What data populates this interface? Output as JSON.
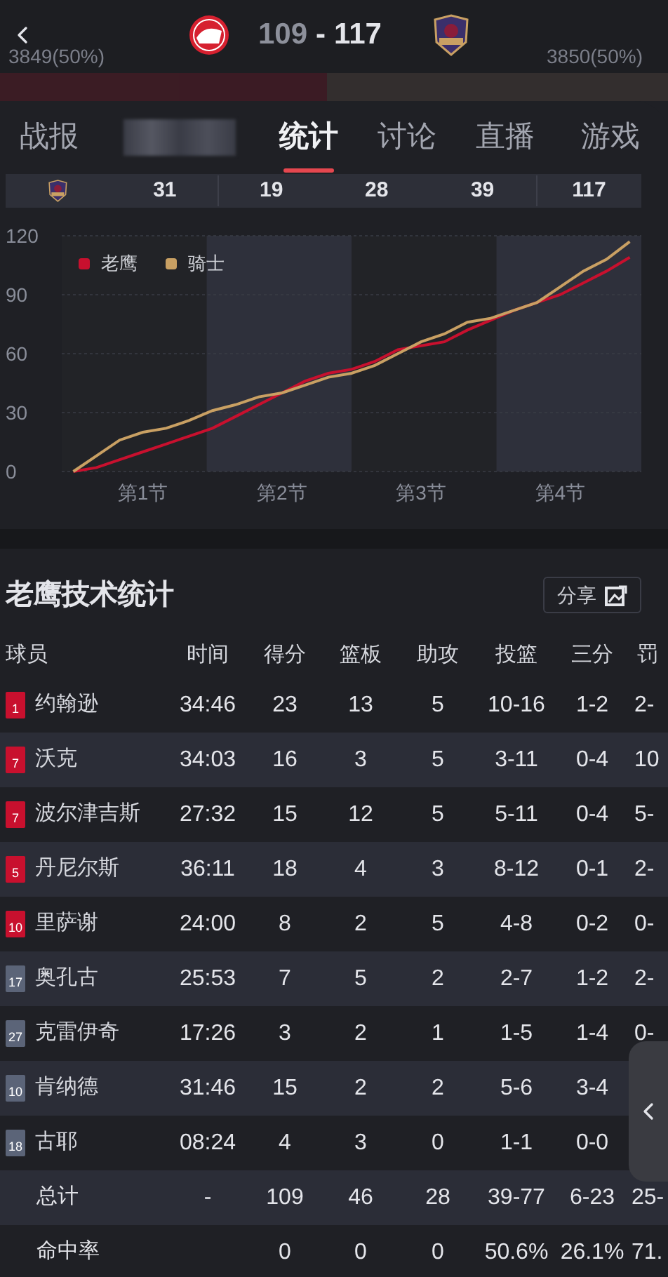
{
  "header": {
    "away_score": "109",
    "separator": "-",
    "home_score": "117",
    "away_votes": "3849(50%)",
    "home_votes": "3850(50%)",
    "vote_bar": {
      "level": 0.49
    }
  },
  "tabs": [
    {
      "kind": "text",
      "label": "战报",
      "selected": false
    },
    {
      "kind": "blurred",
      "selected": false
    },
    {
      "kind": "text",
      "label": "统计",
      "selected": true
    },
    {
      "kind": "text",
      "label": "讨论",
      "selected": false
    },
    {
      "kind": "text",
      "label": "直播",
      "selected": false
    },
    {
      "kind": "text",
      "label": "游戏",
      "selected": false
    }
  ],
  "quarter_row": {
    "cells": [
      "31",
      "19",
      "28",
      "39",
      "117"
    ]
  },
  "score_chart": {
    "chart_data": {
      "type": "line",
      "categories": [
        null,
        null,
        null,
        "第1节",
        null,
        null,
        null,
        null,
        null,
        "第2节",
        null,
        null,
        null,
        null,
        null,
        "第3节",
        null,
        null,
        null,
        null,
        null,
        "第4节",
        null,
        null,
        null
      ],
      "ylim": [
        0,
        120
      ],
      "yticks": [
        0,
        30,
        60,
        90,
        120
      ],
      "grid": true,
      "legend": "top-left",
      "series": [
        {
          "name": "老鹰",
          "color": "#c8102e",
          "values": [
            0,
            2,
            6,
            10,
            14,
            18,
            22,
            28,
            34,
            40,
            46,
            50,
            52,
            56,
            62,
            64,
            66,
            72,
            77,
            82,
            86,
            90,
            96,
            102,
            109
          ]
        },
        {
          "name": "骑士",
          "color": "#c9a063",
          "values": [
            0,
            8,
            16,
            20,
            22,
            26,
            31,
            34,
            38,
            40,
            44,
            48,
            50,
            54,
            60,
            66,
            70,
            76,
            78,
            82,
            86,
            94,
            102,
            108,
            117
          ]
        }
      ]
    }
  },
  "stats": {
    "title": "老鹰技术统计",
    "share_label": "分享",
    "columns": [
      "球员",
      "时间",
      "得分",
      "篮板",
      "助攻",
      "投篮",
      "三分",
      "罚"
    ],
    "rows": [
      {
        "number": "1",
        "starter": true,
        "cells": [
          "约翰逊",
          "34:46",
          "23",
          "13",
          "5",
          "10-16",
          "1-2",
          "2-"
        ]
      },
      {
        "number": "7",
        "starter": true,
        "cells": [
          "沃克",
          "34:03",
          "16",
          "3",
          "5",
          "3-11",
          "0-4",
          "10"
        ]
      },
      {
        "number": "7",
        "starter": true,
        "cells": [
          "波尔津吉斯",
          "27:32",
          "15",
          "12",
          "5",
          "5-11",
          "0-4",
          "5-"
        ]
      },
      {
        "number": "5",
        "starter": true,
        "cells": [
          "丹尼尔斯",
          "36:11",
          "18",
          "4",
          "3",
          "8-12",
          "0-1",
          "2-"
        ]
      },
      {
        "number": "10",
        "starter": true,
        "cells": [
          "里萨谢",
          "24:00",
          "8",
          "2",
          "5",
          "4-8",
          "0-2",
          "0-"
        ]
      },
      {
        "number": "17",
        "starter": false,
        "cells": [
          "奥孔古",
          "25:53",
          "7",
          "5",
          "2",
          "2-7",
          "1-2",
          "2-"
        ]
      },
      {
        "number": "27",
        "starter": false,
        "cells": [
          "克雷伊奇",
          "17:26",
          "3",
          "2",
          "1",
          "1-5",
          "1-4",
          "0-"
        ]
      },
      {
        "number": "10",
        "starter": false,
        "cells": [
          "肯纳德",
          "31:46",
          "15",
          "2",
          "2",
          "5-6",
          "3-4"
        ]
      },
      {
        "number": "18",
        "starter": false,
        "cells": [
          "古耶",
          "08:24",
          "4",
          "3",
          "0",
          "1-1",
          "0-0"
        ]
      }
    ],
    "totals": [
      {
        "cells": [
          "总计",
          "-",
          "109",
          "46",
          "28",
          "39-77",
          "6-23",
          "25-"
        ]
      },
      {
        "cells": [
          "命中率",
          "",
          "0",
          "0",
          "0",
          "50.6%",
          "26.1%",
          "71."
        ]
      }
    ]
  }
}
